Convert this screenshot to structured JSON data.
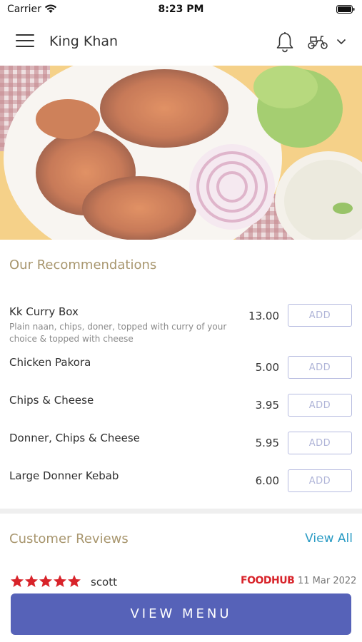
{
  "status_bar": {
    "carrier": "Carrier",
    "time": "8:23 PM"
  },
  "header": {
    "title": "King Khan"
  },
  "icons": {
    "menu": "hamburger-menu-icon",
    "notifications": "bell-icon",
    "delivery": "scooter-icon",
    "dropdown": "chevron-down-icon"
  },
  "recommendations": {
    "title": "Our Recommendations",
    "items": [
      {
        "name": "Kk Curry Box",
        "description": "Plain naan, chips, doner, topped with curry of your choice & topped with cheese",
        "price": "13.00",
        "button": "ADD"
      },
      {
        "name": "Chicken Pakora",
        "description": "",
        "price": "5.00",
        "button": "ADD"
      },
      {
        "name": "Chips & Cheese",
        "description": "",
        "price": "3.95",
        "button": "ADD"
      },
      {
        "name": "Donner, Chips & Cheese",
        "description": "",
        "price": "5.95",
        "button": "ADD"
      },
      {
        "name": "Large Donner Kebab",
        "description": "",
        "price": "6.00",
        "button": "ADD"
      }
    ]
  },
  "reviews": {
    "title": "Customer Reviews",
    "view_all": "View All",
    "items": [
      {
        "rating": 5,
        "reviewer": "scott",
        "source": "FOODHUB",
        "date": "11 Mar 2022"
      }
    ]
  },
  "footer": {
    "button_label": "VIEW MENU"
  },
  "colors": {
    "accent": "#5662b8",
    "section_title": "#a8966e",
    "link": "#2a9bc4",
    "star": "#d8232a",
    "add_border": "#b6bbe0"
  }
}
